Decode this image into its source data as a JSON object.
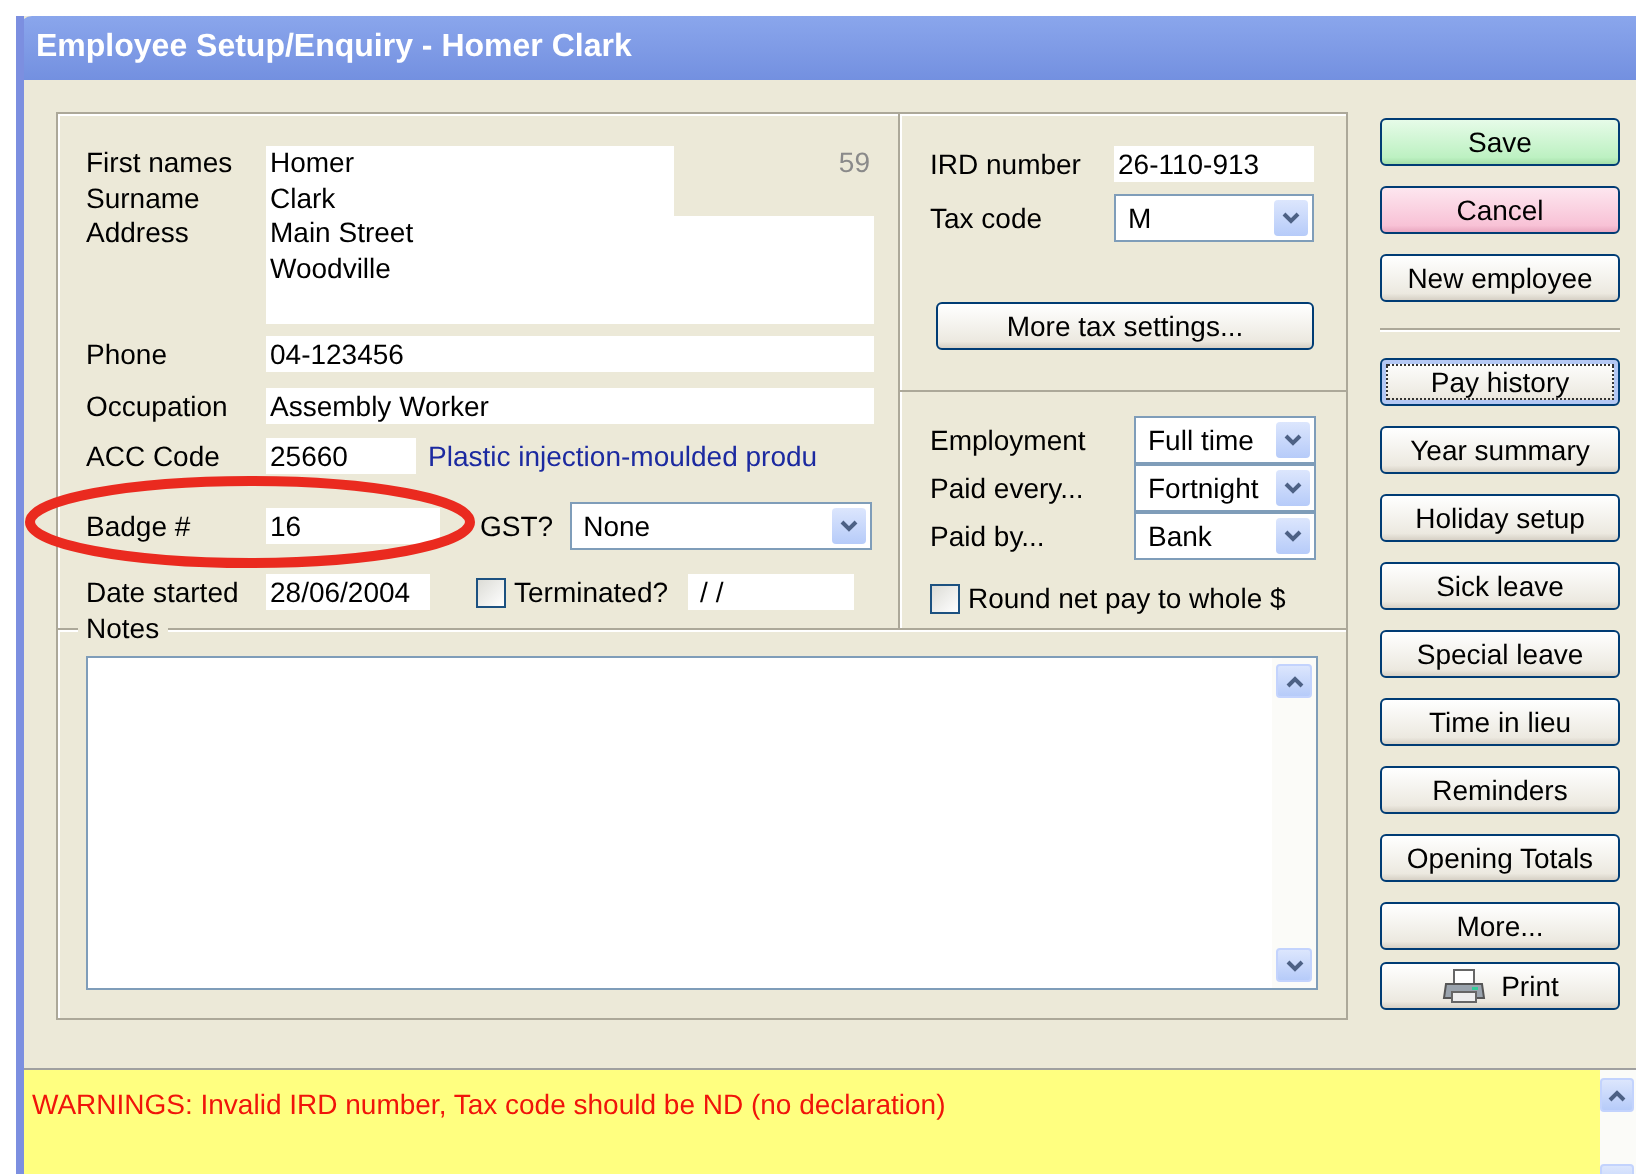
{
  "window": {
    "title": "Employee Setup/Enquiry - Homer Clark"
  },
  "employee_number": "59",
  "name_rows": [
    {
      "label": "First names",
      "value": "Homer"
    },
    {
      "label": "Surname",
      "value": "Clark"
    }
  ],
  "address": {
    "label": "Address",
    "lines": [
      "Main Street",
      "Woodville"
    ]
  },
  "phone": {
    "label": "Phone",
    "value": "04-123456"
  },
  "occupation": {
    "label": "Occupation",
    "value": "Assembly Worker"
  },
  "acc_code": {
    "label": "ACC Code",
    "value": "25660",
    "description": "Plastic injection-moulded produ"
  },
  "badge": {
    "label": "Badge #",
    "value": "16"
  },
  "gst": {
    "label": "GST?",
    "value": "None"
  },
  "date_started": {
    "label": "Date started",
    "value": "28/06/2004"
  },
  "terminated": {
    "label": "Terminated?",
    "checked": false,
    "date": "/ /"
  },
  "tax": {
    "ird_label": "IRD number",
    "ird_value": "26-110-913",
    "code_label": "Tax code",
    "code_value": "M",
    "settings_button": "More tax settings..."
  },
  "pay_rows": [
    {
      "label": "Employment",
      "value": "Full time"
    },
    {
      "label": "Paid every...",
      "value": "Fortnight"
    },
    {
      "label": "Paid by...",
      "value": "Bank"
    }
  ],
  "round_pay": {
    "label": "Round net pay to whole $",
    "checked": false
  },
  "notes": {
    "label": "Notes"
  },
  "buttons_top": [
    {
      "label": "Save",
      "kind": "save",
      "focused": false
    },
    {
      "label": "Cancel",
      "kind": "cancel",
      "focused": false
    },
    {
      "label": "New employee",
      "kind": "normal",
      "focused": false
    }
  ],
  "buttons_bottom": [
    {
      "label": "Pay history",
      "kind": "normal",
      "focused": true
    },
    {
      "label": "Year summary",
      "kind": "normal",
      "focused": false
    },
    {
      "label": "Holiday setup",
      "kind": "normal",
      "focused": false
    },
    {
      "label": "Sick leave",
      "kind": "normal",
      "focused": false
    },
    {
      "label": "Special leave",
      "kind": "normal",
      "focused": false
    },
    {
      "label": "Time in lieu",
      "kind": "normal",
      "focused": false
    },
    {
      "label": "Reminders",
      "kind": "normal",
      "focused": false
    },
    {
      "label": "Opening Totals",
      "kind": "normal",
      "focused": false
    },
    {
      "label": "More...",
      "kind": "normal",
      "focused": false
    },
    {
      "label": "Print",
      "kind": "print",
      "focused": false
    }
  ],
  "warning": "WARNINGS: Invalid IRD number, Tax code should be ND (no declaration)"
}
